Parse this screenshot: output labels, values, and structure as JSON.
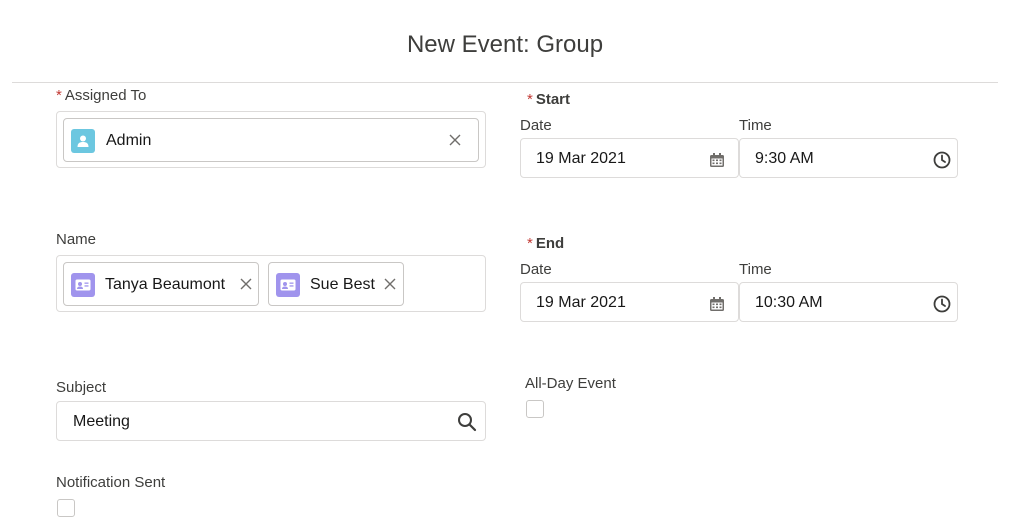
{
  "header": {
    "title": "New Event: Group"
  },
  "assigned_to": {
    "label": "Assigned To",
    "value": "Admin"
  },
  "start": {
    "label": "Start",
    "date_label": "Date",
    "date_value": "19 Mar 2021",
    "time_label": "Time",
    "time_value": "9:30 AM"
  },
  "name_field": {
    "label": "Name",
    "pills": [
      {
        "label": "Tanya Beaumont"
      },
      {
        "label": "Sue Best"
      }
    ]
  },
  "end": {
    "label": "End",
    "date_label": "Date",
    "date_value": "19 Mar 2021",
    "time_label": "Time",
    "time_value": "10:30 AM"
  },
  "subject": {
    "label": "Subject",
    "value": "Meeting"
  },
  "all_day": {
    "label": "All-Day Event",
    "checked": false
  },
  "notification": {
    "label": "Notification Sent",
    "checked": false
  },
  "required_marker": "*",
  "colors": {
    "user_avatar": "#6cc7e0",
    "contact_avatar": "#a094ed",
    "required": "#c23934",
    "border": "#dddbda"
  }
}
